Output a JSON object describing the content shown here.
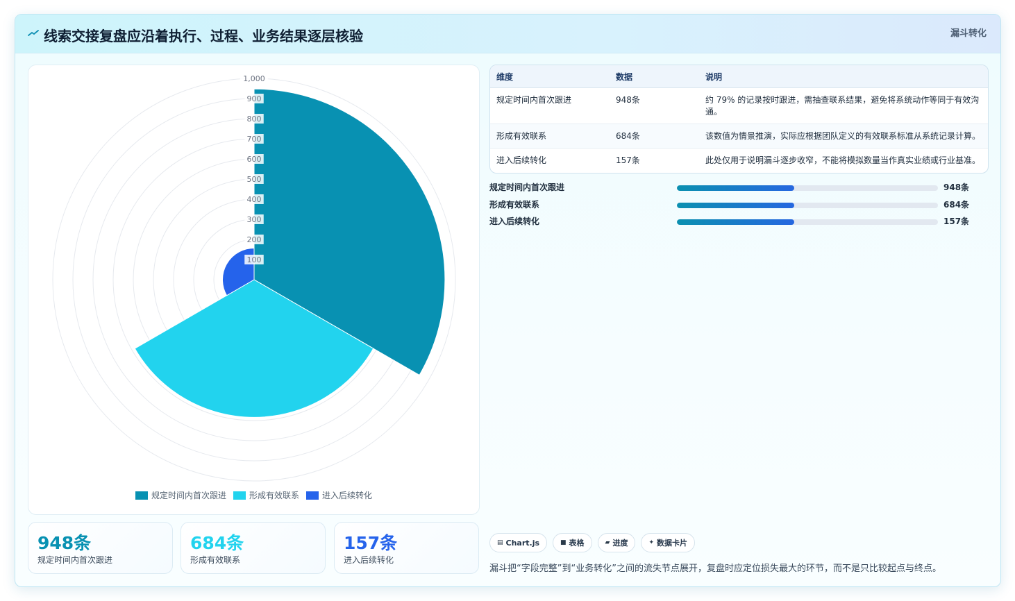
{
  "header": {
    "title": "线索交接复盘应沿着执行、过程、业务结果逐层核验",
    "tag": "漏斗转化"
  },
  "colors": {
    "series": [
      "#0891b2",
      "#22d3ee",
      "#2563eb"
    ],
    "accent": "#0891b2"
  },
  "chart_data": {
    "type": "polarArea",
    "categories": [
      "规定时间内首次跟进",
      "形成有效联系",
      "进入后续转化"
    ],
    "values": [
      948,
      684,
      157
    ],
    "unit": "条",
    "r_range": [
      0,
      1000
    ],
    "r_ticks": [
      "",
      "100",
      "200",
      "300",
      "400",
      "500",
      "600",
      "700",
      "800",
      "900",
      "1,000"
    ],
    "legend_position": "bottom",
    "grid": true
  },
  "stats": [
    {
      "value": "948条",
      "label": "规定时间内首次跟进",
      "color": "#0891b2"
    },
    {
      "value": "684条",
      "label": "形成有效联系",
      "color": "#22d3ee"
    },
    {
      "value": "157条",
      "label": "进入后续转化",
      "color": "#2563eb"
    }
  ],
  "table": {
    "headers": [
      "维度",
      "数据",
      "说明"
    ],
    "rows": [
      {
        "dim": "规定时间内首次跟进",
        "value": "948条",
        "note": "约 79% 的记录按时跟进，需抽查联系结果，避免将系统动作等同于有效沟通。"
      },
      {
        "dim": "形成有效联系",
        "value": "684条",
        "note": "该数值为情景推演，实际应根据团队定义的有效联系标准从系统记录计算。"
      },
      {
        "dim": "进入后续转化",
        "value": "157条",
        "note": "此处仅用于说明漏斗逐步收窄，不能将模拟数量当作真实业绩或行业基准。"
      }
    ]
  },
  "progress": [
    {
      "label": "规定时间内首次跟进",
      "value": "948条",
      "fill": 0.45
    },
    {
      "label": "形成有效联系",
      "value": "684条",
      "fill": 0.45
    },
    {
      "label": "进入后续转化",
      "value": "157条",
      "fill": 0.45
    }
  ],
  "chips": [
    {
      "icon": "▤",
      "label": "Chart.js"
    },
    {
      "icon": "■",
      "label": "表格"
    },
    {
      "icon": "▰",
      "label": "进度"
    },
    {
      "icon": "✦",
      "label": "数据卡片"
    }
  ],
  "footnote": "漏斗把“字段完整”到“业务转化”之间的流失节点展开，复盘时应定位损失最大的环节，而不是只比较起点与终点。"
}
